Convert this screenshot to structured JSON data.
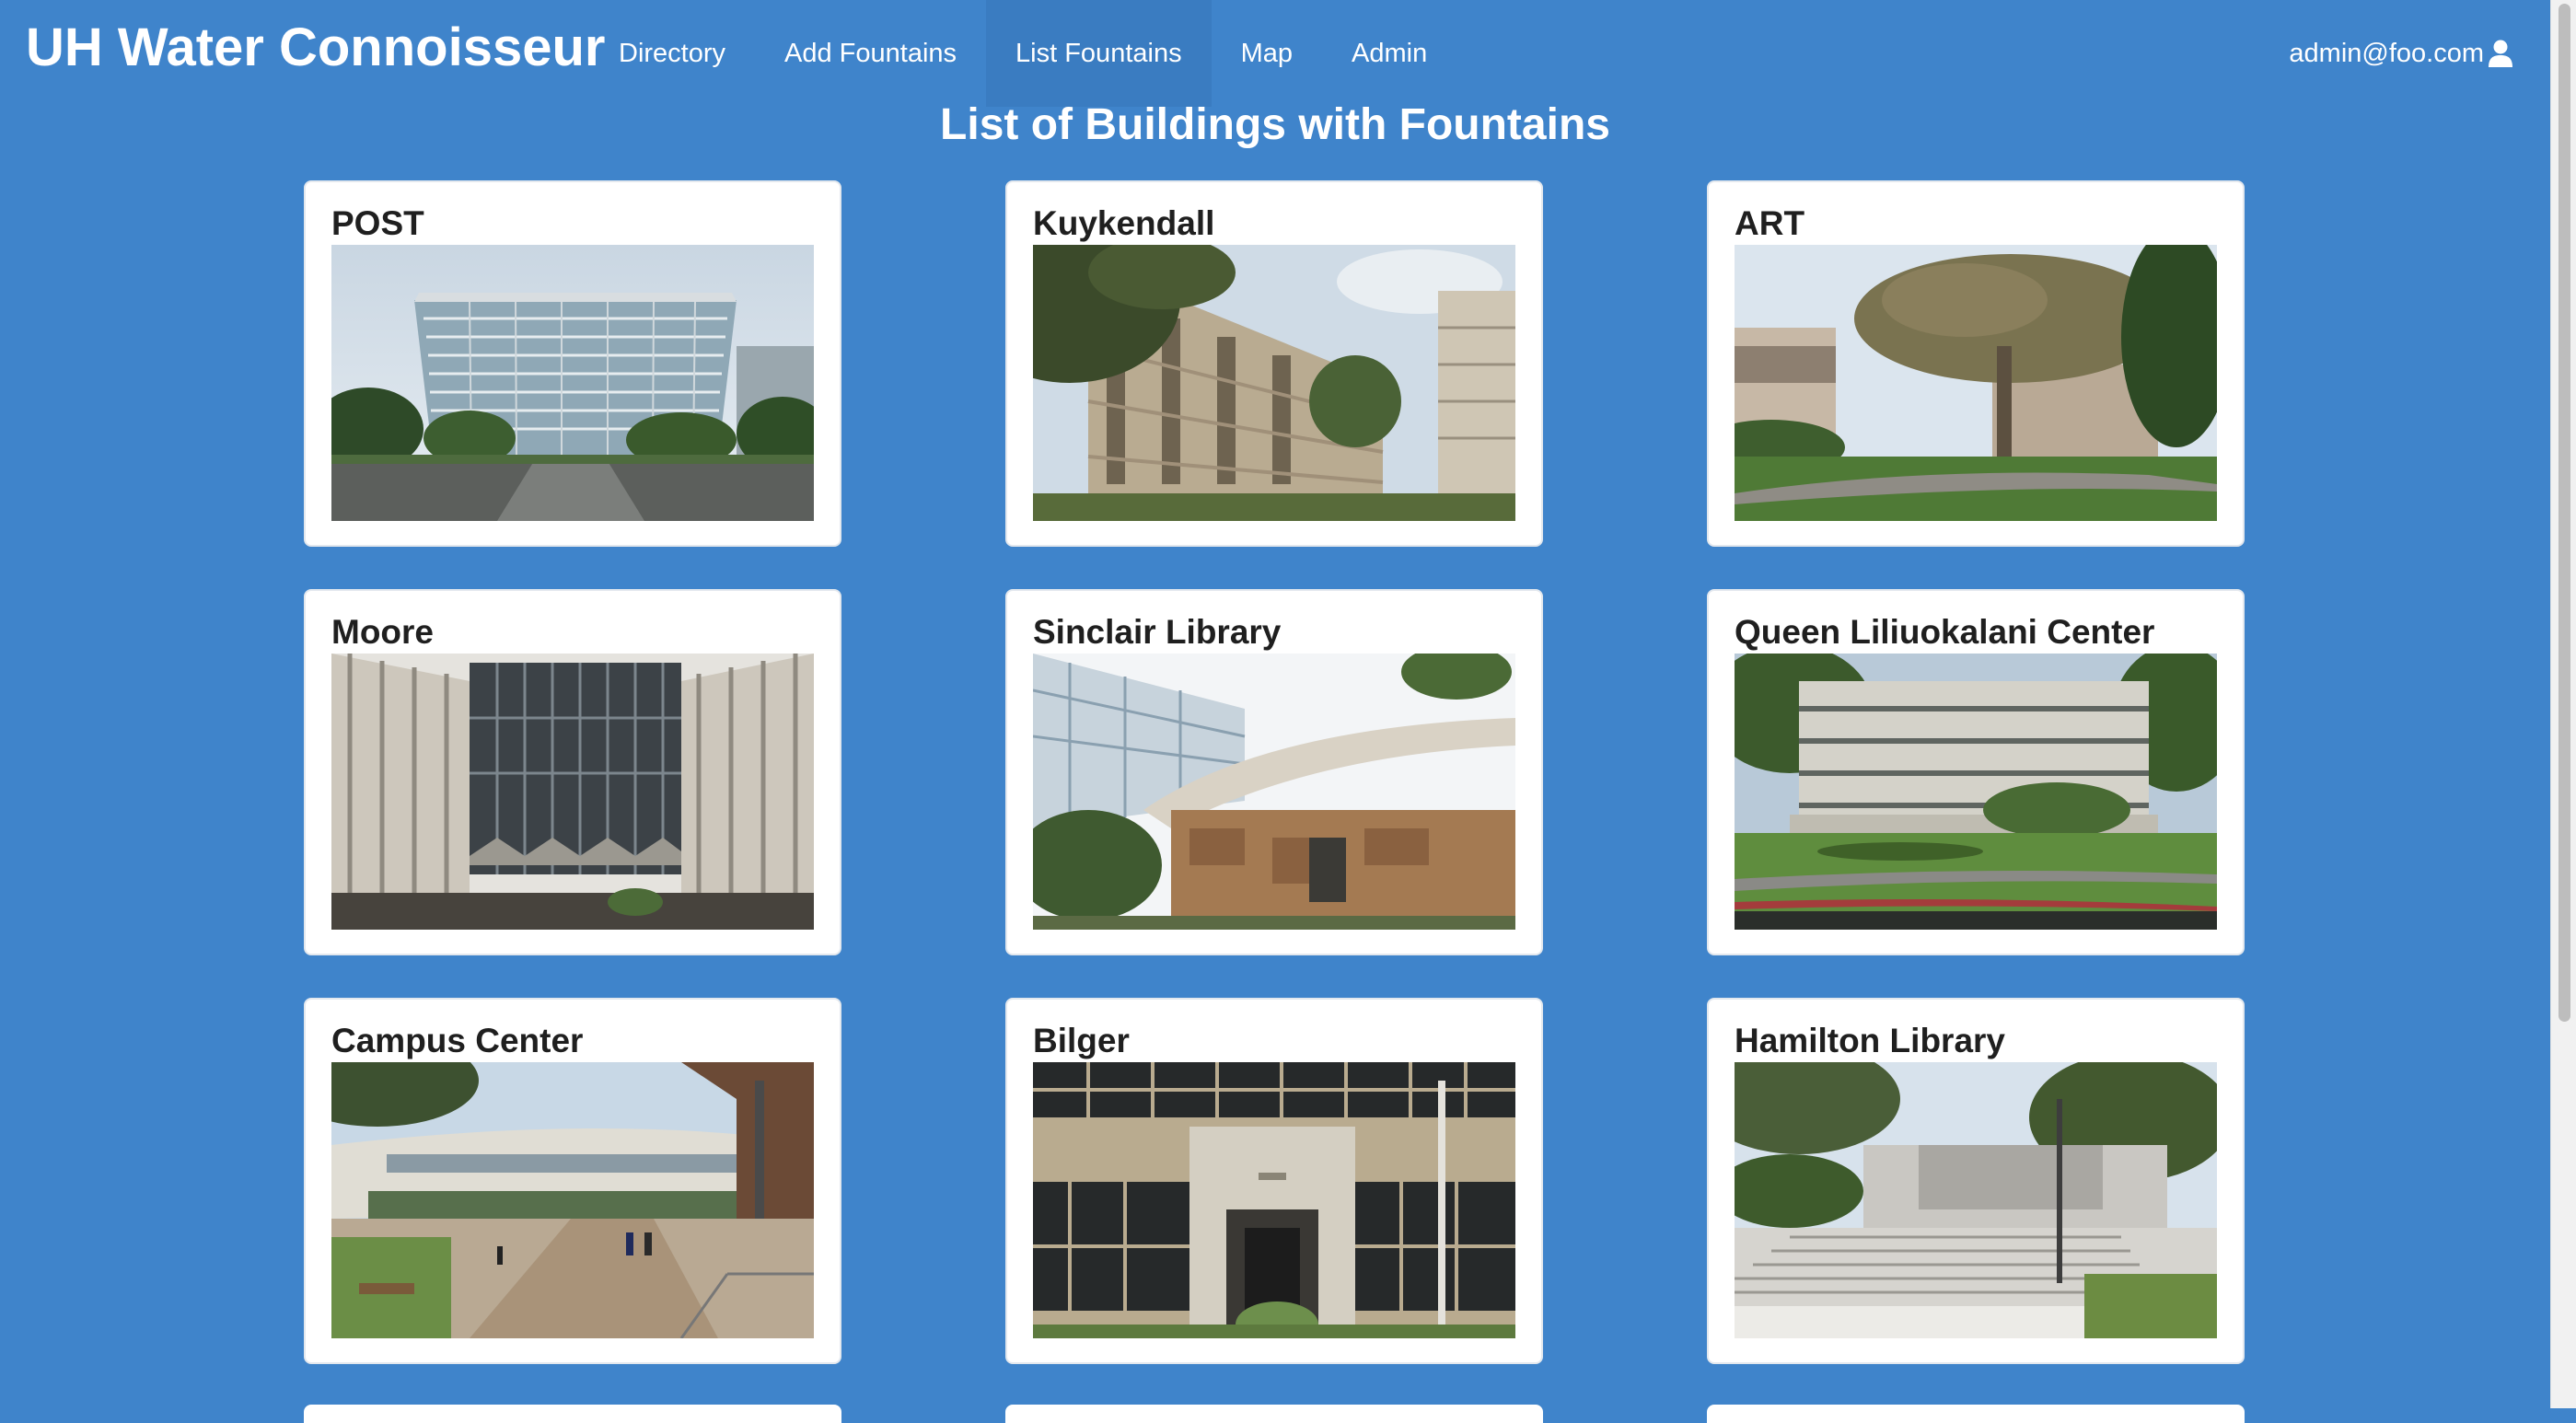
{
  "navbar": {
    "brand": "UH Water Connoisseur",
    "items": [
      {
        "label": "Directory",
        "active": false
      },
      {
        "label": "Add Fountains",
        "active": false
      },
      {
        "label": "List Fountains",
        "active": true
      },
      {
        "label": "Map",
        "active": false
      },
      {
        "label": "Admin",
        "active": false
      }
    ],
    "user": "admin@foo.com",
    "user_icon": "user-icon"
  },
  "page": {
    "title": "List of Buildings with Fountains"
  },
  "buildings": [
    {
      "name": "POST"
    },
    {
      "name": "Kuykendall"
    },
    {
      "name": "ART"
    },
    {
      "name": "Moore"
    },
    {
      "name": "Sinclair Library"
    },
    {
      "name": "Queen Liliuokalani Center"
    },
    {
      "name": "Campus Center"
    },
    {
      "name": "Bilger"
    },
    {
      "name": "Hamilton Library"
    }
  ],
  "colors": {
    "background": "#3f84cb",
    "nav_active": "#3a7cc1",
    "card": "#ffffff",
    "text": "#1f1f1f"
  }
}
